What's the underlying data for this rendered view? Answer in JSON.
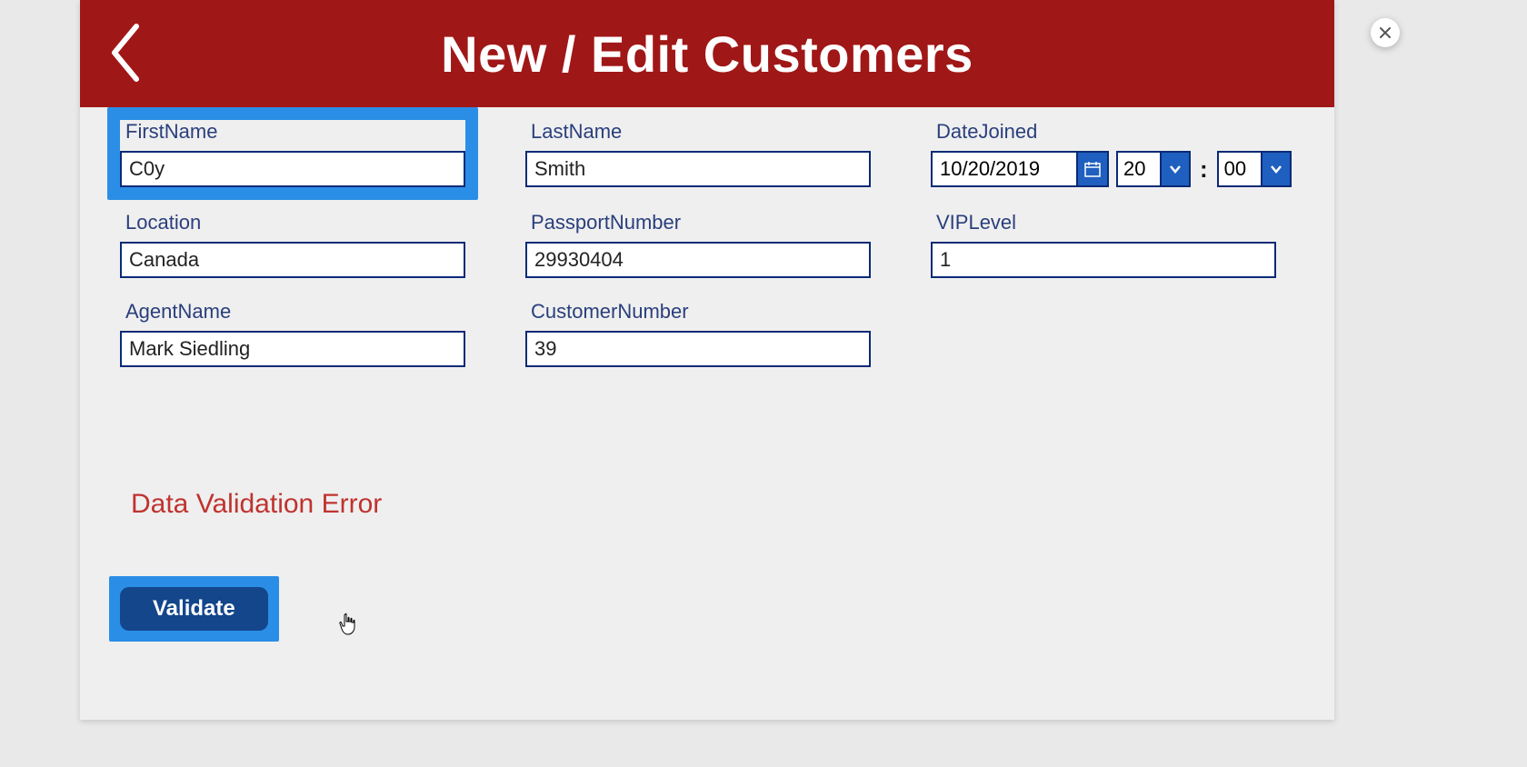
{
  "header": {
    "title": "New / Edit Customers"
  },
  "fields": {
    "first_name": {
      "label": "FirstName",
      "value": "C0y"
    },
    "last_name": {
      "label": "LastName",
      "value": "Smith"
    },
    "date_joined": {
      "label": "DateJoined",
      "date": "10/20/2019",
      "hour": "20",
      "minute": "00"
    },
    "location": {
      "label": "Location",
      "value": "Canada"
    },
    "passport_number": {
      "label": "PassportNumber",
      "value": "29930404"
    },
    "vip_level": {
      "label": "VIPLevel",
      "value": "1"
    },
    "agent_name": {
      "label": "AgentName",
      "value": "Mark Siedling"
    },
    "customer_number": {
      "label": "CustomerNumber",
      "value": "39"
    }
  },
  "error": "Data Validation Error",
  "actions": {
    "validate": "Validate"
  },
  "time_separator": ":"
}
